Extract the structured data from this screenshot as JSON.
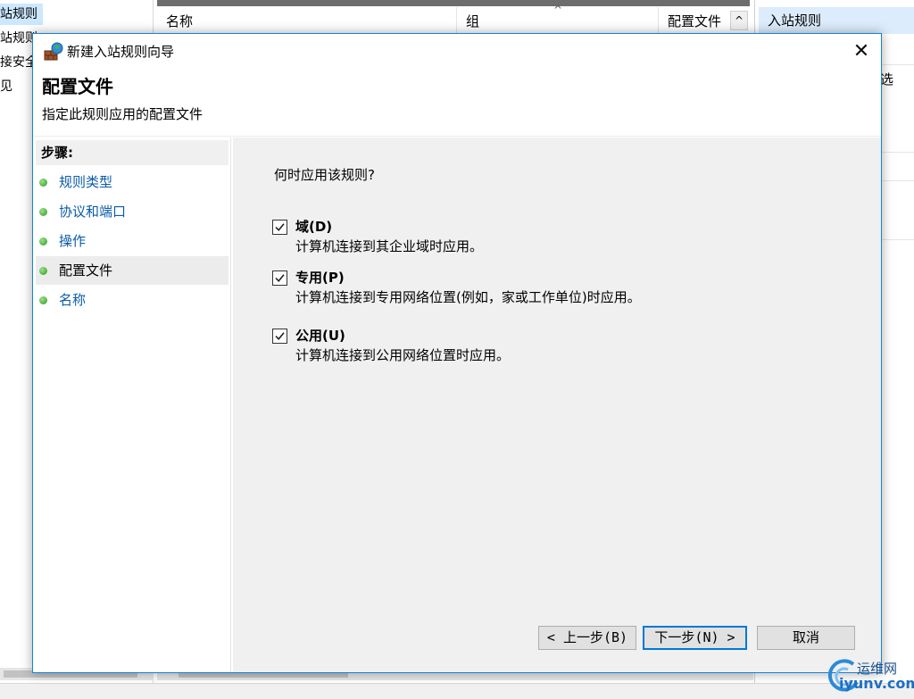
{
  "background": {
    "tree_items": [
      "站规则",
      "站规则",
      "接安全",
      "见"
    ],
    "columns": [
      "名称",
      "组",
      "配置文件"
    ],
    "actions_header": "入站规则",
    "actions_partial_text": "选"
  },
  "dialog": {
    "title": "新建入站规则向导",
    "header_title": "配置文件",
    "header_subtitle": "指定此规则应用的配置文件",
    "steps_title": "步骤:",
    "steps": [
      {
        "label": "规则类型",
        "active": false
      },
      {
        "label": "协议和端口",
        "active": false
      },
      {
        "label": "操作",
        "active": false
      },
      {
        "label": "配置文件",
        "active": true
      },
      {
        "label": "名称",
        "active": false
      }
    ],
    "question": "何时应用该规则?",
    "options": [
      {
        "label": "域(D)",
        "description": "计算机连接到其企业域时应用。",
        "checked": true
      },
      {
        "label": "专用(P)",
        "description": "计算机连接到专用网络位置(例如，家或工作单位)时应用。",
        "checked": true
      },
      {
        "label": "公用(U)",
        "description": "计算机连接到公用网络位置时应用。",
        "checked": true
      }
    ],
    "buttons": {
      "back": "< 上一步(B)",
      "next": "下一步(N) >",
      "cancel": "取消"
    }
  },
  "watermark": {
    "cn": "运维网",
    "domain": "iyunv.com"
  },
  "colors": {
    "dialog_border": "#1883d7",
    "step_link": "#0a5ba8",
    "content_bg": "#f0f0f0",
    "default_button_border": "#0078d7"
  }
}
